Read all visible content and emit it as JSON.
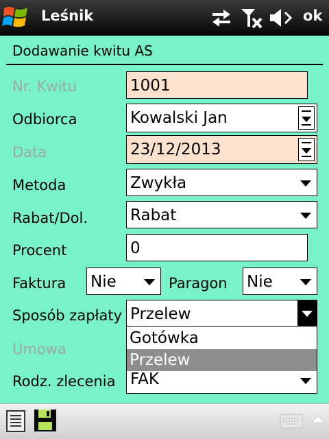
{
  "titlebar": {
    "app_title": "Leśnik",
    "ok_label": "ok",
    "icons": [
      "windows-start-icon",
      "data-connection-icon",
      "no-signal-icon",
      "volume-muted-icon"
    ]
  },
  "form": {
    "heading": "Dodawanie kwitu AS",
    "nr_kwitu": {
      "label": "Nr. Kwitu",
      "value": "1001",
      "disabled": true
    },
    "odbiorca": {
      "label": "Odbiorca",
      "value": "Kowalski Jan"
    },
    "data": {
      "label": "Data",
      "value": "23/12/2013",
      "disabled": true
    },
    "metoda": {
      "label": "Metoda",
      "value": "Zwykła"
    },
    "rabat": {
      "label": "Rabat/Dol.",
      "value": "Rabat"
    },
    "procent": {
      "label": "Procent",
      "value": "0"
    },
    "faktura": {
      "label": "Faktura",
      "value": "Nie"
    },
    "paragon": {
      "label": "Paragon",
      "value": "Nie"
    },
    "sposob_zaplaty": {
      "label": "Sposób zapłaty",
      "value": "Przelew",
      "open": true,
      "options": [
        "Gotówka",
        "Przelew"
      ],
      "selected_option": "Przelew"
    },
    "umowa": {
      "label": "Umowa",
      "disabled": true
    },
    "rodz_zlecenia": {
      "label": "Rodz. zlecenia",
      "value": "FAK"
    }
  },
  "bottombar": {
    "icons": [
      "list-icon",
      "save-icon",
      "keyboard-icon",
      "menu-up-icon"
    ]
  },
  "colors": {
    "background": "#78f2c9",
    "readonly_field": "#fce1cc",
    "disabled_label": "#9fa7a3",
    "selected_option": "#8e8e8e"
  }
}
